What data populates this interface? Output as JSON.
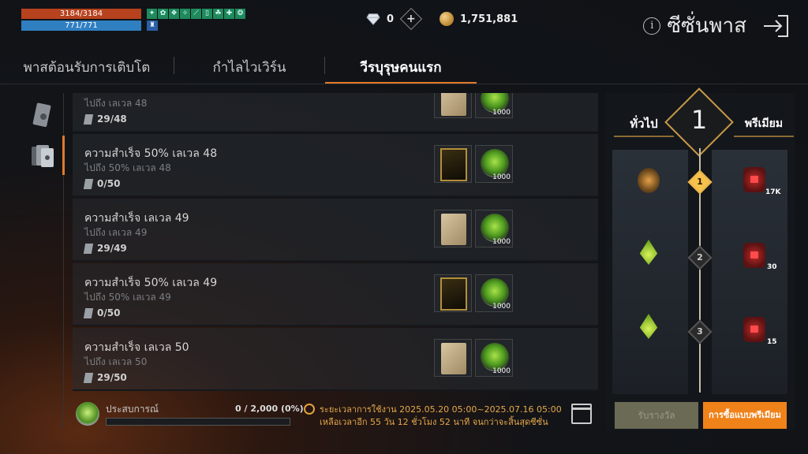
{
  "hud": {
    "hp": "3184/3184",
    "mp": "771/771",
    "buff_count": 9
  },
  "currency": {
    "diamonds": "0",
    "gold": "1,751,881"
  },
  "header": {
    "title": "ซีซั่นพาส"
  },
  "tabs": [
    {
      "label": "พาสต้อนรับการเติบโต",
      "active": false
    },
    {
      "label": "กำไลไวเวิร์น",
      "active": false
    },
    {
      "label": "วีรบุรุษคนแรก",
      "active": true
    }
  ],
  "missions": [
    {
      "title": "",
      "sub": "ไปถึง เลเวล 48",
      "progress": "29/48",
      "reward1": "scroll",
      "qty": "1000"
    },
    {
      "title": "ความสำเร็จ 50% เลเวล 48",
      "sub": "ไปถึง 50% เลเวล 48",
      "progress": "0/50",
      "reward1": "card",
      "qty": "1000"
    },
    {
      "title": "ความสำเร็จ เลเวล 49",
      "sub": "ไปถึง เลเวล 49",
      "progress": "29/49",
      "reward1": "scroll",
      "qty": "1000"
    },
    {
      "title": "ความสำเร็จ 50% เลเวล 49",
      "sub": "ไปถึง 50% เลเวล 49",
      "progress": "0/50",
      "reward1": "card",
      "qty": "1000"
    },
    {
      "title": "ความสำเร็จ เลเวล 50",
      "sub": "ไปถึง เลเวล 50",
      "progress": "29/50",
      "reward1": "scroll",
      "qty": "1000"
    }
  ],
  "bottom": {
    "exp_label": "ประสบการณ์",
    "exp_value": "0 / 2,000 (0%)",
    "exp_fraction": 0,
    "period_line1": "ระยะเวลาการใช้งาน 2025.05.20 05:00~2025.07.16 05:00",
    "period_line2": "เหลือเวลาอีก 55 วัน 12 ชั่วโมง 52 นาที จนกว่าจะสิ้นสุดซีซั่น"
  },
  "pass": {
    "free_label": "ทั่วไป",
    "premium_label": "พรีเมียม",
    "level": "1",
    "tiers": [
      {
        "num": "1",
        "active": true,
        "premium_qty": "17K"
      },
      {
        "num": "2",
        "active": false,
        "premium_qty": "30"
      },
      {
        "num": "3",
        "active": false,
        "premium_qty": "15"
      }
    ],
    "claim_label": "รับรางวัล",
    "premium_button": "การซื้อแบบพรีเมียม"
  }
}
